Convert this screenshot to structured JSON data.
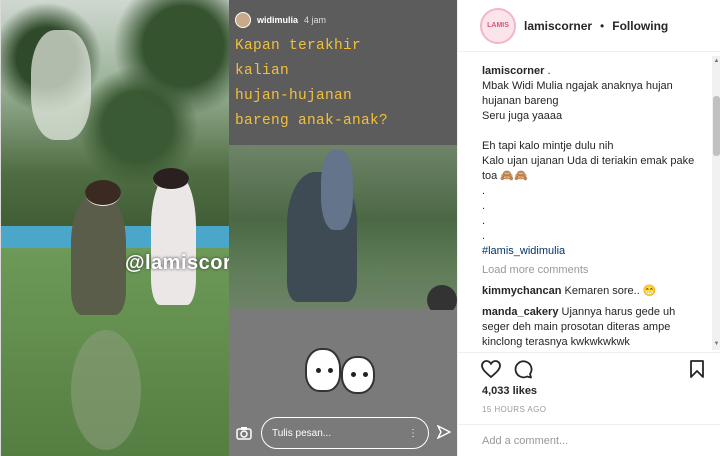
{
  "photo": {
    "watermark": "@lamiscorner"
  },
  "story": {
    "username": "widimulia",
    "time": "4 jam",
    "text_lines": [
      "Kapan terakhir",
      "kalian",
      "hujan-hujanan",
      "bareng anak-anak?"
    ],
    "message_placeholder": "Tulis pesan...",
    "more_dots": "⋮",
    "camera_icon": "camera-icon",
    "send_icon": "send-icon"
  },
  "post": {
    "username": "lamiscorner",
    "separator": "•",
    "follow_status": "Following",
    "avatar_text": "LAMIS",
    "caption_user": "lamiscorner",
    "caption_suffix": ".",
    "caption_lines": [
      "Mbak Widi Mulia ngajak anaknya hujan",
      "hujanan bareng",
      "Seru juga yaaaa",
      "",
      "Eh tapi kalo mintje dulu nih",
      "Kalo ujan ujanan Uda di teriakin emak pake",
      "toa 🙈🙈",
      ".",
      ".",
      ".",
      "."
    ],
    "hashtag": "#lamis_widimulia",
    "load_more": "Load more comments",
    "comments": [
      {
        "user": "kimmychancan",
        "text": "Kemaren sore.. 😁"
      },
      {
        "user": "manda_cakery",
        "text": "Ujannya harus gede uh seger deh main prosotan diteras ampe kinclong terasnya kwkwkwkwk"
      }
    ],
    "likes": "4,033 likes",
    "timestamp": "15 HOURS AGO",
    "add_comment_placeholder": "Add a comment..."
  },
  "colors": {
    "story_text": "#f1c03b",
    "hashtag": "#003569",
    "muted": "#999999"
  }
}
